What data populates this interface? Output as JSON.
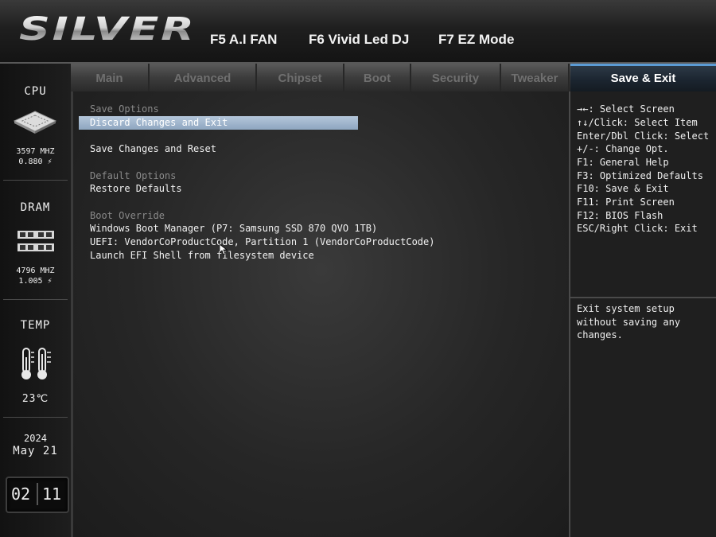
{
  "header": {
    "logo": "SILVER",
    "hotkeys": [
      "F5 A.I FAN",
      "F6 Vivid Led DJ",
      "F7 EZ Mode"
    ]
  },
  "sidebar": {
    "cpu": {
      "label": "CPU",
      "freq": "3597 MHZ",
      "volt": "0.880 ⚡"
    },
    "dram": {
      "label": "DRAM",
      "freq": "4796 MHZ",
      "volt": "1.005 ⚡"
    },
    "temp": {
      "label": "TEMP",
      "value": "23℃"
    },
    "date": {
      "year": "2024",
      "monthday": "May 21"
    },
    "time": {
      "hour": "02",
      "minute": "11"
    }
  },
  "tabs": [
    "Main",
    "Advanced",
    "Chipset",
    "Boot",
    "Security",
    "Tweaker",
    "Save & Exit"
  ],
  "active_tab": "Save & Exit",
  "main": {
    "save_options_header": "Save Options",
    "discard_exit": "Discard Changes and Exit",
    "save_reset": "Save Changes and Reset",
    "default_options_header": "Default Options",
    "restore_defaults": "Restore Defaults",
    "boot_override_header": "Boot Override",
    "boot_items": [
      "Windows Boot Manager (P7: Samsung SSD 870 QVO 1TB)",
      "UEFI: VendorCoProductCode, Partition 1 (VendorCoProductCode)",
      "Launch EFI Shell from filesystem device"
    ]
  },
  "help": {
    "keys": [
      "→←: Select Screen",
      "↑↓/Click: Select Item",
      "Enter/Dbl Click: Select",
      "+/-: Change Opt.",
      "F1: General Help",
      "F3: Optimized Defaults",
      "F10: Save & Exit",
      "F11: Print Screen",
      "F12: BIOS Flash",
      "ESC/Right Click: Exit"
    ],
    "description": [
      "Exit system setup",
      "without saving any",
      "changes."
    ]
  },
  "colors": {
    "selection": "#9fb4cc",
    "active_tab_accent": "#5b9bd5",
    "header_text": "#8a8a8a"
  }
}
